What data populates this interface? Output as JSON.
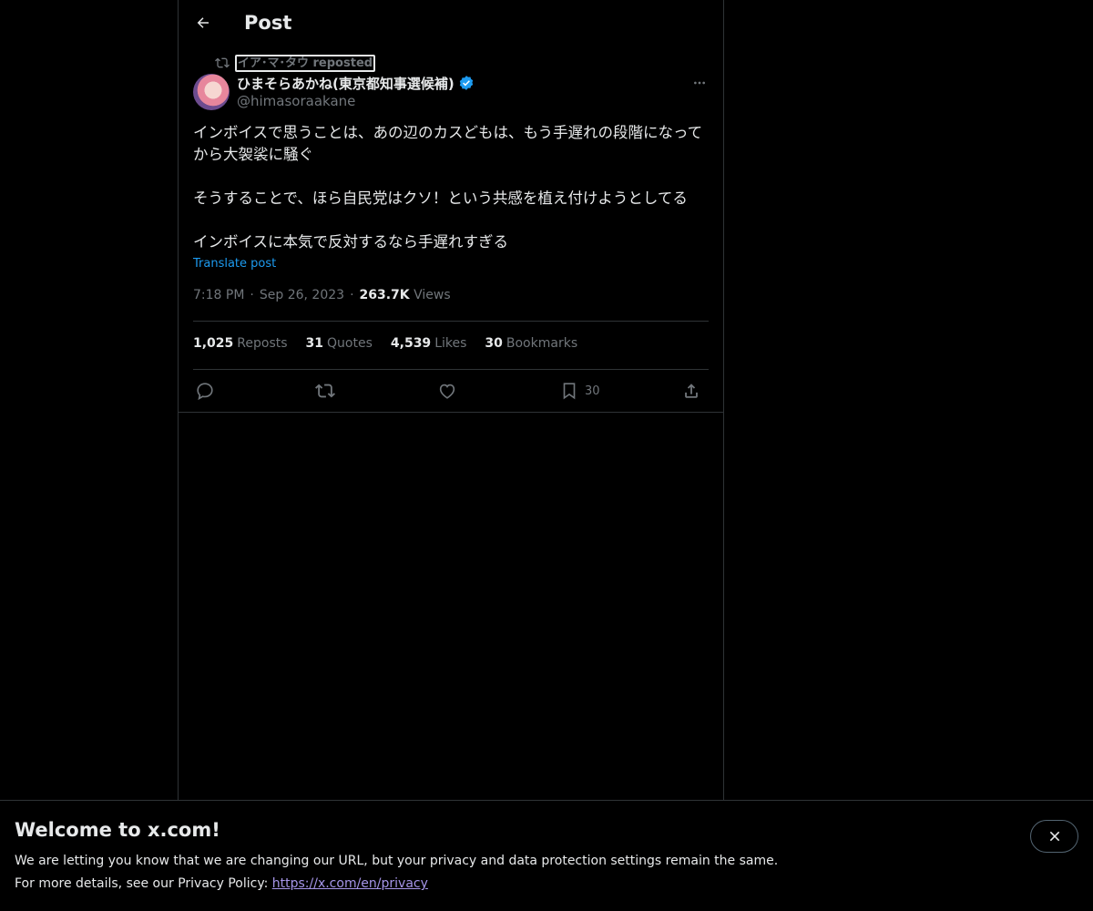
{
  "header": {
    "title": "Post"
  },
  "post": {
    "reposted_by": "イア･マ･タウ reposted",
    "author": {
      "display_name": "ひまそらあかね(東京都知事選候補)",
      "handle": "@himasoraakane",
      "verified": true
    },
    "text": [
      "インボイスで思うことは、あの辺のカスどもは、もう手遅れの段階になってから大袈裟に騒ぐ",
      "そうすることで、ほら自民党はクソ！という共感を植え付けようとしてる",
      "インボイスに本気で反対するなら手遅れすぎる"
    ],
    "translate_label": "Translate post",
    "time": "7:18 PM",
    "date": "Sep 26, 2023",
    "views_count": "263.7K",
    "views_label": "Views",
    "separator": "·",
    "stats": {
      "reposts_count": "1,025",
      "reposts_label": "Reposts",
      "quotes_count": "31",
      "quotes_label": "Quotes",
      "likes_count": "4,539",
      "likes_label": "Likes",
      "bookmarks_count": "30",
      "bookmarks_label": "Bookmarks"
    },
    "actions": {
      "reply_icon": "reply-icon",
      "repost_icon": "repost-icon",
      "like_icon": "heart-icon",
      "bookmark_icon": "bookmark-icon",
      "bookmark_count": "30",
      "share_icon": "share-icon"
    }
  },
  "banner": {
    "title": "Welcome to x.com!",
    "line1": "We are letting you know that we are changing our URL, but your privacy and data protection settings remain the same.",
    "line2_prefix": "For more details, see our Privacy Policy: ",
    "link": "https://x.com/en/privacy"
  },
  "colors": {
    "background": "#000000",
    "text": "#e7e9ea",
    "secondary": "#71767b",
    "accent": "#1d9bf0",
    "border": "#2f3336",
    "link": "#a595e8"
  }
}
